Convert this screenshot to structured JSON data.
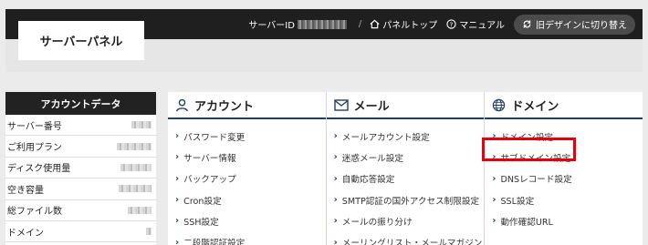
{
  "header": {
    "server_id_label": "サーバーID",
    "panel_top": "パネルトップ",
    "manual": "マニュアル",
    "old_design": "旧デザインに切り替え"
  },
  "logo": {
    "text": "サーバーパネル"
  },
  "sidebar": {
    "title": "アカウントデータ",
    "rows": [
      {
        "label": "サーバー番号"
      },
      {
        "label": "ご利用プラン"
      },
      {
        "label": "ディスク使用量"
      },
      {
        "label": "空き容量"
      },
      {
        "label": "総ファイル数"
      },
      {
        "label": "ドメイン"
      }
    ]
  },
  "columns": [
    {
      "title": "アカウント",
      "icon": "user-icon",
      "items": [
        "パスワード変更",
        "サーバー情報",
        "バックアップ",
        "Cron設定",
        "SSH設定",
        "二段階認証設定"
      ]
    },
    {
      "title": "メール",
      "icon": "mail-icon",
      "items": [
        "メールアカウント設定",
        "迷惑メール設定",
        "自動応答設定",
        "SMTP認証の国外アクセス制限設定",
        "メールの振り分け",
        "メーリングリスト・メールマガジン"
      ]
    },
    {
      "title": "ドメイン",
      "icon": "globe-icon",
      "items": [
        "ドメイン設定",
        "サブドメイン設定",
        "DNSレコード設定",
        "SSL設定",
        "動作確認URL"
      ]
    }
  ],
  "colors": {
    "accent": "#1f3f6b",
    "highlight": "#e8000f",
    "topbar": "#1f1f1f"
  }
}
